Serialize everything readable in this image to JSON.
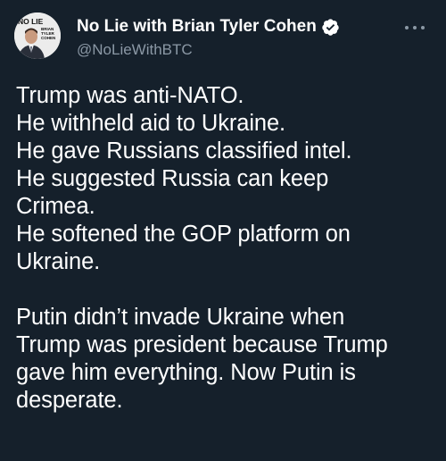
{
  "tweet": {
    "author": {
      "display_name": "No Lie with Brian Tyler Cohen",
      "handle": "@NoLieWithBTC",
      "avatar_text": "NO LIE with BRIAN TYLER COHEN",
      "verified": true
    },
    "menu_icon": "more-options-icon",
    "paragraph1": [
      "Trump was anti-NATO.",
      "He withheld aid to Ukraine.",
      "He gave Russians classified intel.",
      "He suggested Russia can keep",
      "Crimea.",
      "He softened the GOP platform on",
      "Ukraine."
    ],
    "paragraph2": [
      "Putin didn’t invade Ukraine when",
      "Trump was president because Trump",
      "gave him everything. Now Putin is",
      "desperate."
    ]
  },
  "colors": {
    "background": "#15202b",
    "text": "#ffffff",
    "secondary_text": "#8b98a5",
    "verified_badge": "#ffffff"
  }
}
